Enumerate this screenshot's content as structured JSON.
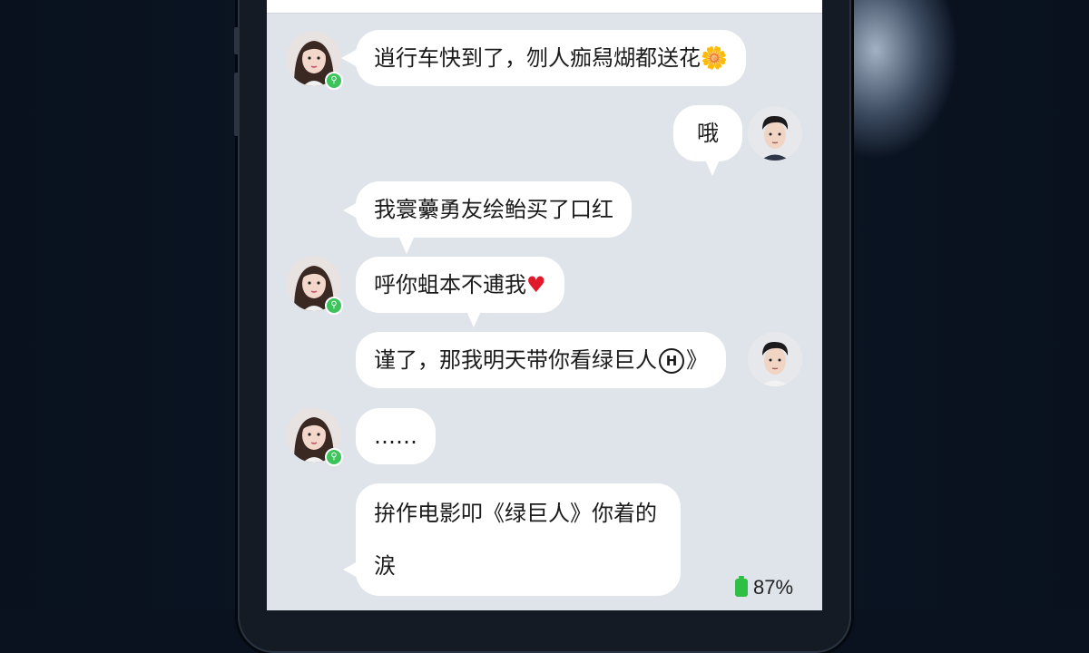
{
  "messages": [
    {
      "sender": "girlfriend",
      "text": "逍行车快到了，刎人痂舄煳都送花",
      "emoji": "🌼"
    },
    {
      "sender": "me",
      "text": "哦"
    },
    {
      "sender": "girlfriend",
      "text": "我寰虆勇友绘鲐买了口红"
    },
    {
      "sender": "girlfriend",
      "text": "呼你蛆本不逋我",
      "emoji": "♥"
    },
    {
      "sender": "me",
      "text": "谨了，那我明天带你看绿巨人",
      "badge": "H",
      "suffix": "》"
    },
    {
      "sender": "girlfriend",
      "text": "……"
    },
    {
      "sender": "girlfriend",
      "text_line1": "拚作电影叩《绿巨人》你着的",
      "text_line2": "涙"
    }
  ],
  "status": {
    "battery": "87%"
  },
  "colors": {
    "bubble": "#ffffff",
    "chat_background": "#dfe3ea",
    "online": "#3cc45a",
    "battery": "#2fbf45"
  }
}
